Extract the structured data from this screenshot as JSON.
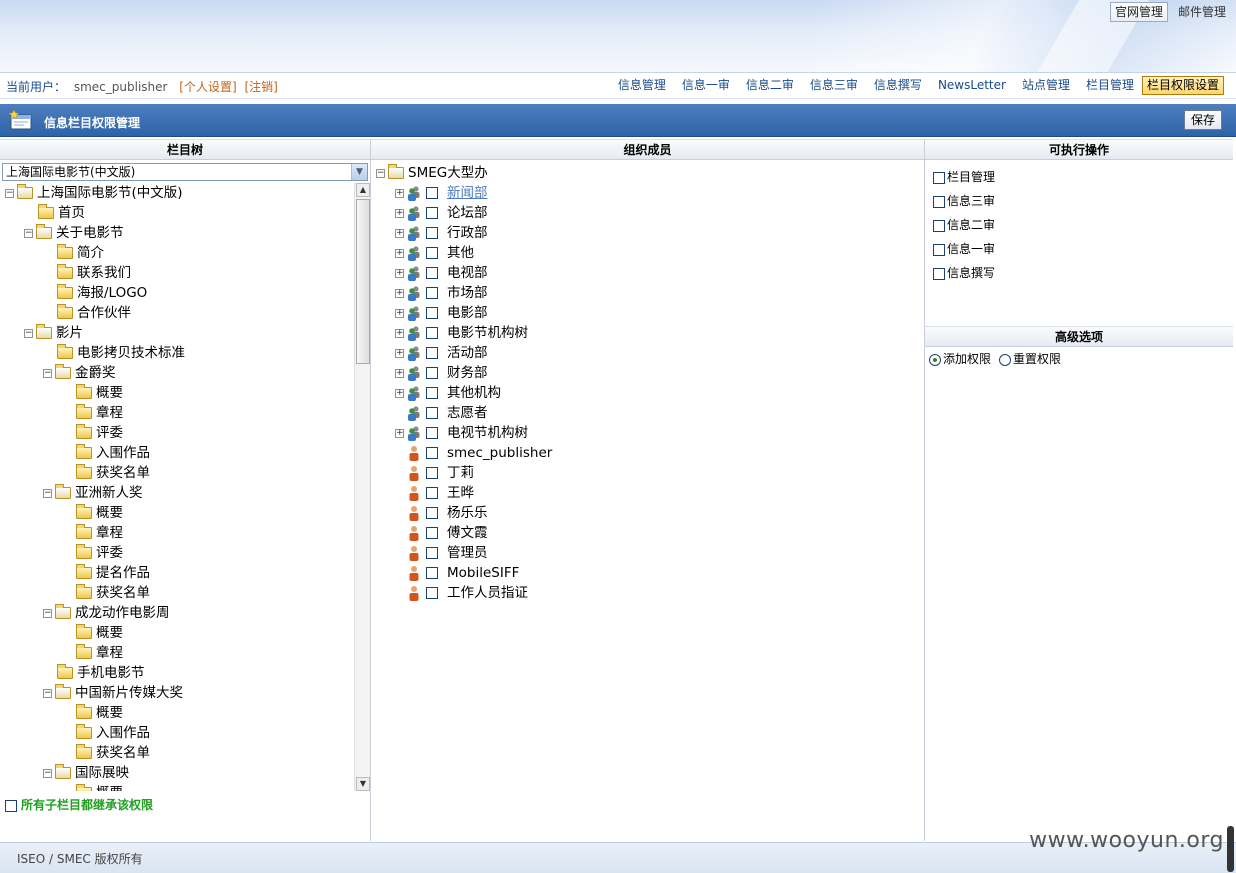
{
  "top_links": {
    "official_admin": "官网管理",
    "mail_admin": "邮件管理"
  },
  "user_bar": {
    "current_user_label": "当前用户：",
    "username": "smec_publisher",
    "personal_settings": "[个人设置]",
    "logout": "[注销]"
  },
  "nav": [
    {
      "label": "信息管理"
    },
    {
      "label": "信息一审"
    },
    {
      "label": "信息二审"
    },
    {
      "label": "信息三审"
    },
    {
      "label": "信息撰写"
    },
    {
      "label": "NewsLetter"
    },
    {
      "label": "站点管理"
    },
    {
      "label": "栏目管理"
    },
    {
      "label": "栏目权限设置",
      "active": true
    }
  ],
  "page_title": "信息栏目权限管理",
  "save_label": "保存",
  "left_panel": {
    "header": "栏目树",
    "select_value": "上海国际电影节(中文版)",
    "tree": [
      {
        "label": "上海国际电影节(中文版)",
        "level": 0,
        "exp": "-",
        "open": true
      },
      {
        "label": "首页",
        "level": 1
      },
      {
        "label": "关于电影节",
        "level": 1,
        "exp": "-",
        "open": true
      },
      {
        "label": "简介",
        "level": 2
      },
      {
        "label": "联系我们",
        "level": 2
      },
      {
        "label": "海报/LOGO",
        "level": 2
      },
      {
        "label": "合作伙伴",
        "level": 2
      },
      {
        "label": "影片",
        "level": 1,
        "exp": "-",
        "open": true
      },
      {
        "label": "电影拷贝技术标准",
        "level": 2
      },
      {
        "label": "金爵奖",
        "level": 2,
        "exp": "-",
        "open": true
      },
      {
        "label": "概要",
        "level": 3
      },
      {
        "label": "章程",
        "level": 3
      },
      {
        "label": "评委",
        "level": 3
      },
      {
        "label": "入围作品",
        "level": 3
      },
      {
        "label": "获奖名单",
        "level": 3
      },
      {
        "label": "亚洲新人奖",
        "level": 2,
        "exp": "-",
        "open": true
      },
      {
        "label": "概要",
        "level": 3
      },
      {
        "label": "章程",
        "level": 3
      },
      {
        "label": "评委",
        "level": 3
      },
      {
        "label": "提名作品",
        "level": 3
      },
      {
        "label": "获奖名单",
        "level": 3
      },
      {
        "label": "成龙动作电影周",
        "level": 2,
        "exp": "-",
        "open": true
      },
      {
        "label": "概要",
        "level": 3
      },
      {
        "label": "章程",
        "level": 3
      },
      {
        "label": "手机电影节",
        "level": 2
      },
      {
        "label": "中国新片传媒大奖",
        "level": 2,
        "exp": "-",
        "open": true
      },
      {
        "label": "概要",
        "level": 3
      },
      {
        "label": "入围作品",
        "level": 3
      },
      {
        "label": "获奖名单",
        "level": 3
      },
      {
        "label": "国际展映",
        "level": 2,
        "exp": "-",
        "open": true
      },
      {
        "label": "概要",
        "level": 3
      }
    ],
    "inherit_label": "所有子栏目都继承该权限"
  },
  "mid_panel": {
    "header": "组织成员",
    "root": "SMEG大型办",
    "members": [
      {
        "label": "新闻部",
        "type": "group",
        "exp": true,
        "link": true
      },
      {
        "label": "论坛部",
        "type": "group",
        "exp": true
      },
      {
        "label": "行政部",
        "type": "group",
        "exp": true
      },
      {
        "label": "其他",
        "type": "group",
        "exp": true
      },
      {
        "label": "电视部",
        "type": "group",
        "exp": true
      },
      {
        "label": "市场部",
        "type": "group",
        "exp": true
      },
      {
        "label": "电影部",
        "type": "group",
        "exp": true
      },
      {
        "label": "电影节机构树",
        "type": "group",
        "exp": true
      },
      {
        "label": "活动部",
        "type": "group",
        "exp": true
      },
      {
        "label": "财务部",
        "type": "group",
        "exp": true
      },
      {
        "label": "其他机构",
        "type": "group",
        "exp": true
      },
      {
        "label": "志愿者",
        "type": "group",
        "exp": false
      },
      {
        "label": "电视节机构树",
        "type": "group",
        "exp": true
      },
      {
        "label": "smec_publisher",
        "type": "user"
      },
      {
        "label": "丁莉",
        "type": "user"
      },
      {
        "label": "王晔",
        "type": "user"
      },
      {
        "label": "杨乐乐",
        "type": "user"
      },
      {
        "label": "傅文霞",
        "type": "user"
      },
      {
        "label": "管理员",
        "type": "user"
      },
      {
        "label": "MobileSIFF",
        "type": "user"
      },
      {
        "label": "工作人员指证",
        "type": "user"
      }
    ]
  },
  "right_panel": {
    "header": "可执行操作",
    "ops": [
      "栏目管理",
      "信息三审",
      "信息二审",
      "信息一审",
      "信息撰写"
    ],
    "advanced_header": "高级选项",
    "add_permission": "添加权限",
    "reset_permission": "重置权限"
  },
  "footer": {
    "copyright": "ISEO / SMEC 版权所有"
  },
  "watermark": "www.wooyun.org",
  "colors": {
    "title_bar": "#3a6db0",
    "nav_link": "#1a4b8c",
    "inherit_text": "#20a020",
    "user_link": "#c0651a"
  }
}
